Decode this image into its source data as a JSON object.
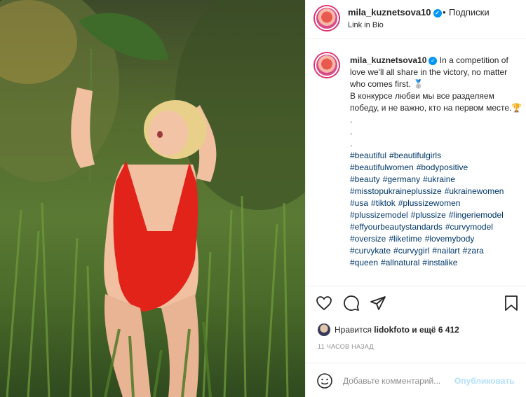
{
  "post": {
    "username": "mila_kuznetsova10",
    "verified": true,
    "follow_separator": "•",
    "follow_label": "Подписки",
    "subtitle": "Link in Bio"
  },
  "caption": {
    "username": "mila_kuznetsova10",
    "lines": [
      "In a competition of love we'll all share in the victory, no matter who comes first. 🥈",
      "В конкурсе любви мы все разделяем победу, и не важно, кто на первом месте.🏆",
      ".",
      ".",
      "."
    ],
    "hashtags": [
      "#beautiful",
      "#beautifulgirls",
      "#beautifulwomen",
      "#bodypositive",
      "#beauty",
      "#germany",
      "#ukraine",
      "#misstopukraineplussize",
      "#ukrainewomen",
      "#usa",
      "#tiktok",
      "#plussizewomen",
      "#plussizemodel",
      "#plussize",
      "#lingeriemodel",
      "#effyourbeautystandards",
      "#curvymodel",
      "#oversize",
      "#liketime",
      "#lovemybody",
      "#curvykate",
      "#curvygirl",
      "#nailart",
      "#zara",
      "#queen",
      "#allnatural",
      "#instalike"
    ]
  },
  "actions": {
    "like_icon": "heart-icon",
    "comment_icon": "comment-icon",
    "share_icon": "paper-plane-icon",
    "save_icon": "bookmark-icon"
  },
  "likes": {
    "prefix": "Нравится",
    "user": "lidokfoto",
    "suffix": "и ещё 6 412"
  },
  "timestamp": "11 ЧАСОВ НАЗАД",
  "comment_input": {
    "placeholder": "Добавьте комментарий...",
    "publish_label": "Опубликовать",
    "emoji_icon": "smiley-icon"
  },
  "colors": {
    "link": "#00376b",
    "accent": "#0095f6",
    "muted": "#8e8e8e",
    "publish_disabled": "#b2dffc"
  }
}
